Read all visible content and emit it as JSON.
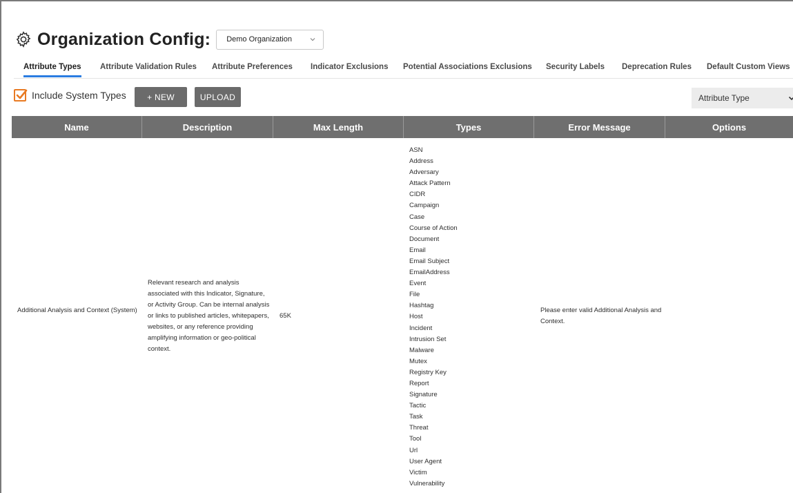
{
  "header": {
    "title": "Organization Config:",
    "organization_select": "Demo Organization"
  },
  "tabs": [
    {
      "label": "Attribute Types",
      "active": true
    },
    {
      "label": "Attribute Validation Rules",
      "active": false
    },
    {
      "label": "Attribute Preferences",
      "active": false
    },
    {
      "label": "Indicator Exclusions",
      "active": false
    },
    {
      "label": "Potential Associations Exclusions",
      "active": false
    },
    {
      "label": "Security Labels",
      "active": false
    },
    {
      "label": "Deprecation Rules",
      "active": false
    },
    {
      "label": "Default Custom Views",
      "active": false
    }
  ],
  "toolbar": {
    "include_system_types_label": "Include System Types",
    "include_system_types_checked": true,
    "new_label": "+  NEW",
    "upload_label": "UPLOAD",
    "type_select": "Attribute Type"
  },
  "table": {
    "columns": [
      "Name",
      "Description",
      "Max Length",
      "Types",
      "Error Message",
      "Options"
    ],
    "rows": [
      {
        "name": "Additional Analysis and Context (System)",
        "description": "Relevant research and analysis associated with this Indicator, Signature, or Activity Group. Can be internal analysis or links to published articles, whitepapers, websites, or any reference providing amplifying information or geo-political context.",
        "max_length": "65K",
        "types": [
          "ASN",
          "Address",
          "Adversary",
          "Attack Pattern",
          "CIDR",
          "Campaign",
          "Case",
          "Course of Action",
          "Document",
          "Email",
          "Email Subject",
          "EmailAddress",
          "Event",
          "File",
          "Hashtag",
          "Host",
          "Incident",
          "Intrusion Set",
          "Malware",
          "Mutex",
          "Registry Key",
          "Report",
          "Signature",
          "Tactic",
          "Task",
          "Threat",
          "Tool",
          "Url",
          "User Agent",
          "Victim",
          "Vulnerability"
        ],
        "error_message": "Please enter valid Additional Analysis and Context.",
        "options": ""
      }
    ]
  },
  "colors": {
    "accent_tab": "#2a7de1",
    "checkbox": "#e87a22",
    "header_bg": "#6f6f6f",
    "button_bg": "#6b6b6b"
  }
}
